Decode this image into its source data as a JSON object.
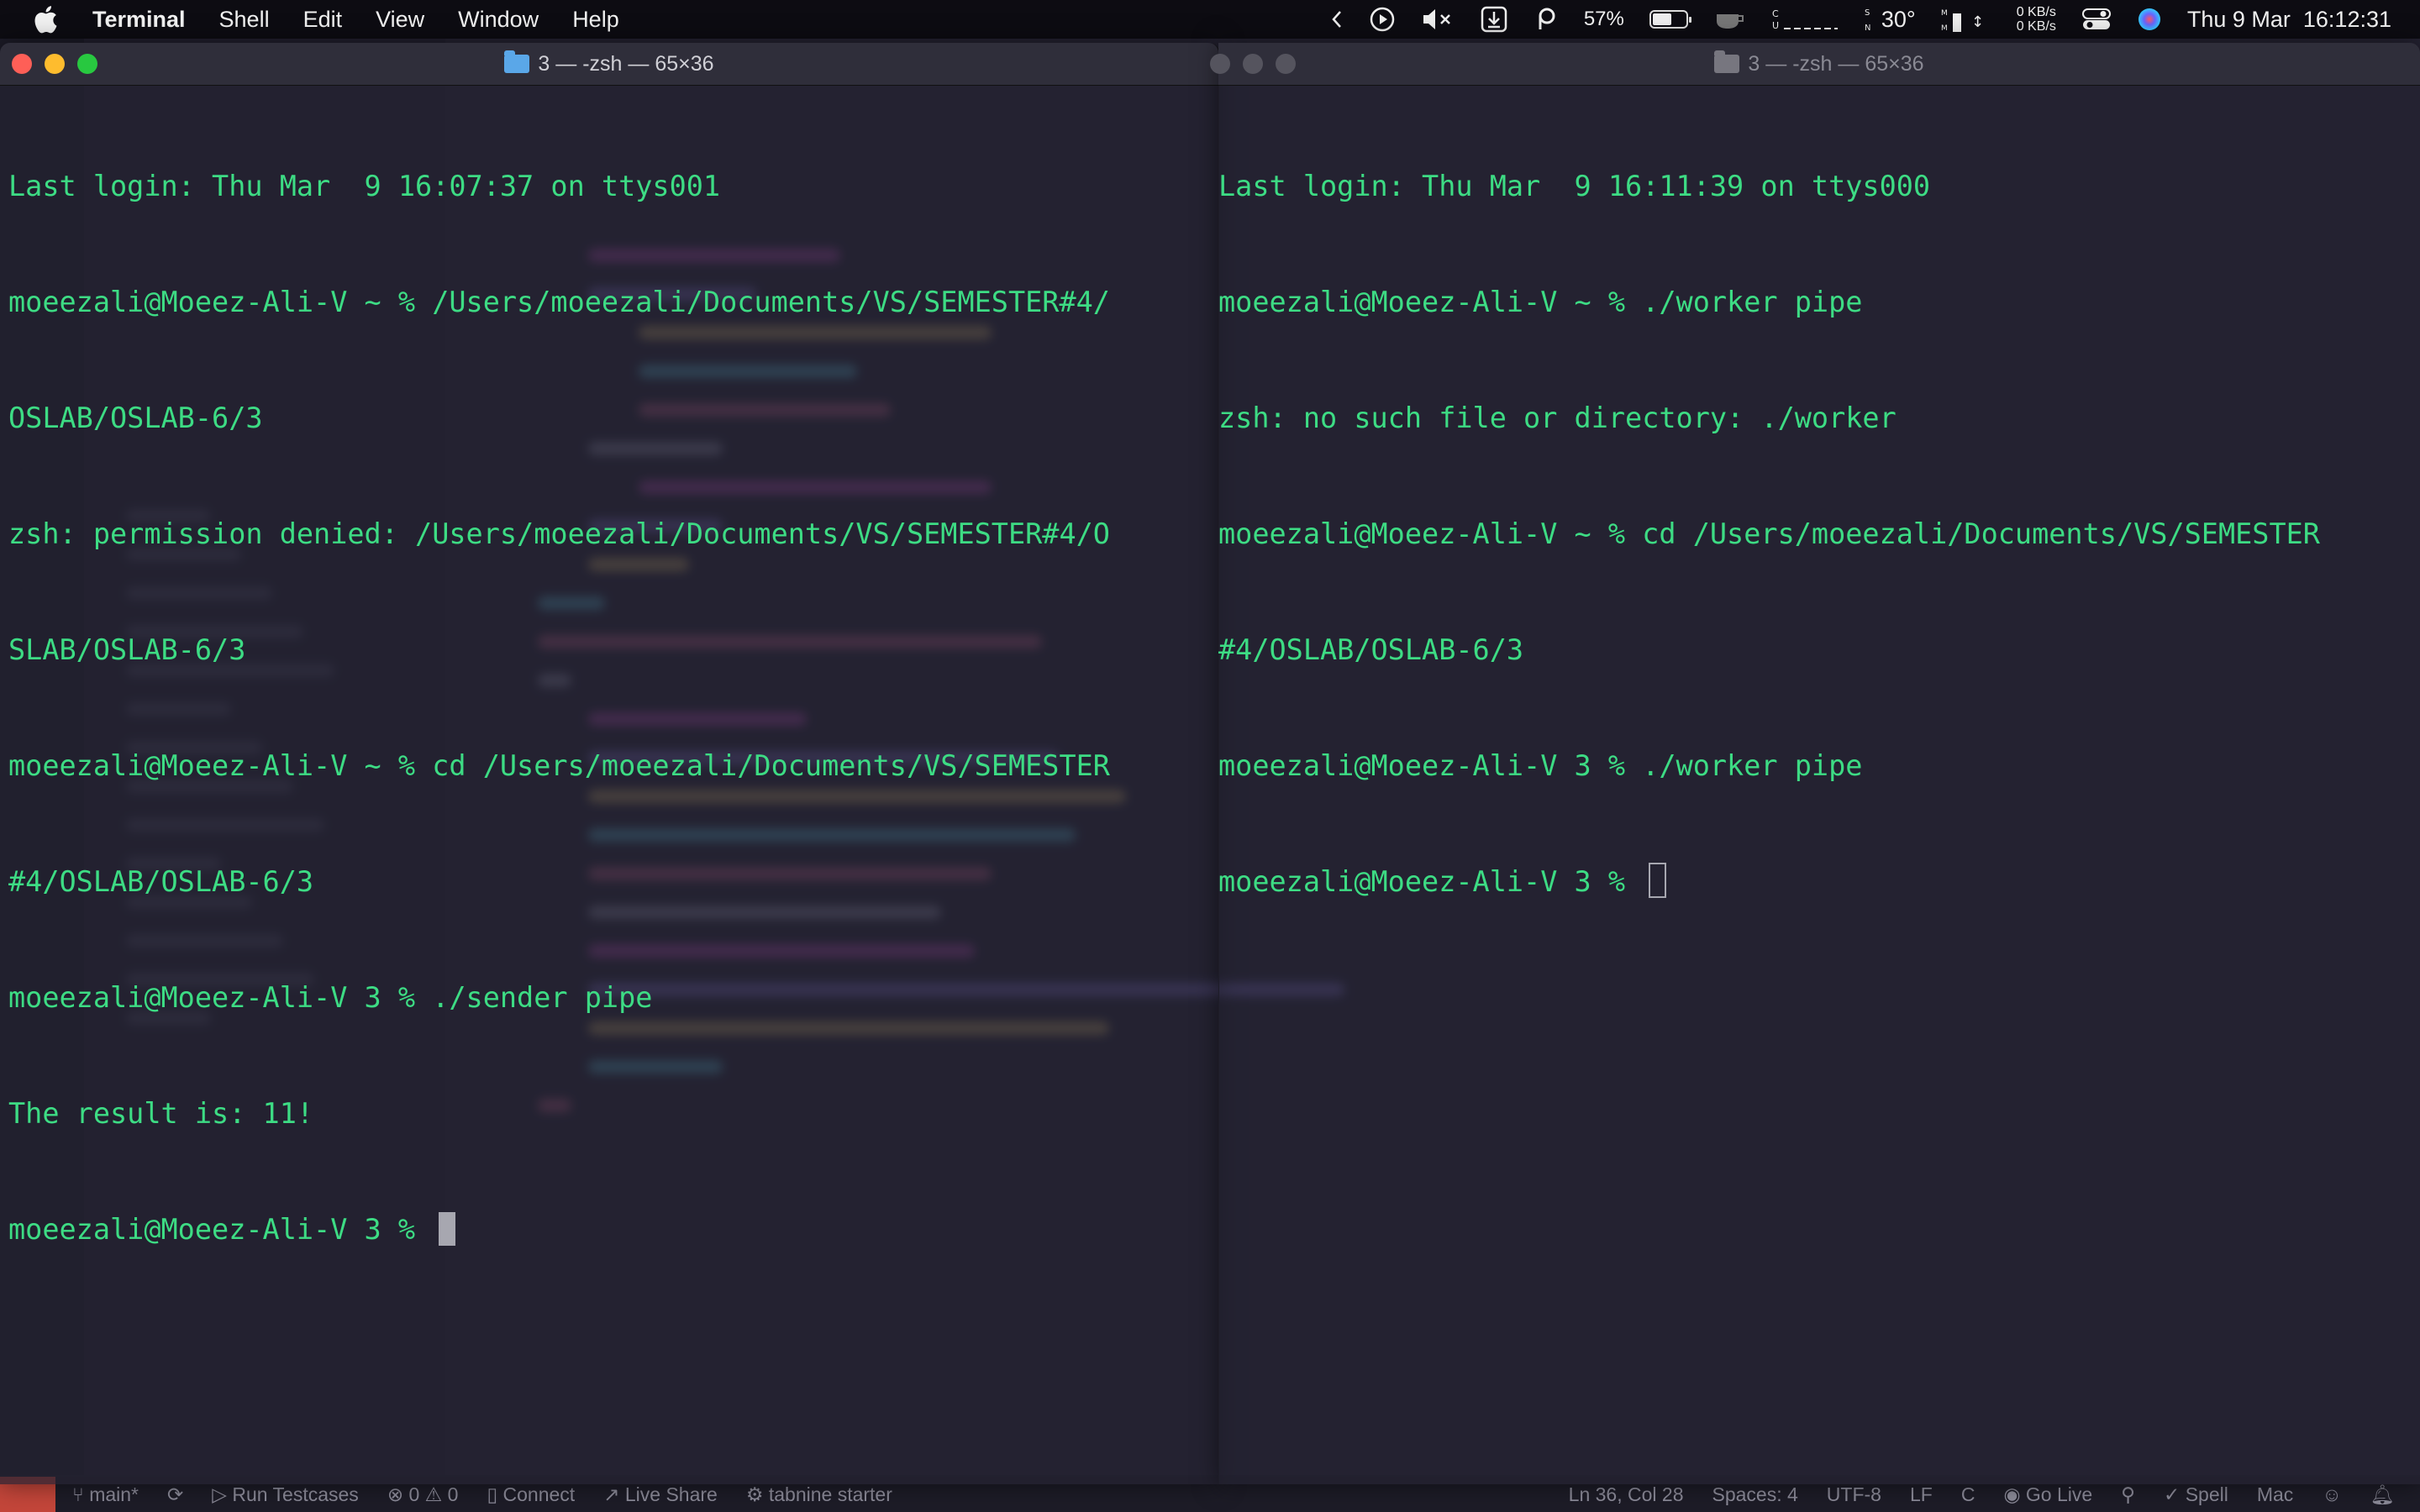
{
  "menubar": {
    "app_name": "Terminal",
    "menus": [
      "Shell",
      "Edit",
      "View",
      "Window",
      "Help"
    ],
    "battery_percent": "57%",
    "battery_level": 0.57,
    "temperature": "30°",
    "net_up": "0 KB/s",
    "net_down": "0 KB/s",
    "datetime": "Thu 9 Mar  16:12:31"
  },
  "left_terminal": {
    "title": "3 — -zsh — 65×36",
    "lines": [
      "Last login: Thu Mar  9 16:07:37 on ttys001",
      "moeezali@Moeez-Ali-V ~ % /Users/moeezali/Documents/VS/SEMESTER#4/",
      "OSLAB/OSLAB-6/3",
      "zsh: permission denied: /Users/moeezali/Documents/VS/SEMESTER#4/O",
      "SLAB/OSLAB-6/3",
      "moeezali@Moeez-Ali-V ~ % cd /Users/moeezali/Documents/VS/SEMESTER",
      "#4/OSLAB/OSLAB-6/3",
      "moeezali@Moeez-Ali-V 3 % ./sender pipe",
      "The result is: 11!"
    ],
    "prompt": "moeezali@Moeez-Ali-V 3 % "
  },
  "right_terminal": {
    "title": "3 — -zsh — 65×36",
    "lines": [
      "Last login: Thu Mar  9 16:11:39 on ttys000",
      "moeezali@Moeez-Ali-V ~ % ./worker pipe",
      "zsh: no such file or directory: ./worker",
      "moeezali@Moeez-Ali-V ~ % cd /Users/moeezali/Documents/VS/SEMESTER",
      "#4/OSLAB/OSLAB-6/3",
      "moeezali@Moeez-Ali-V 3 % ./worker pipe"
    ],
    "prompt": "moeezali@Moeez-Ali-V 3 % "
  },
  "statusbar": {
    "branch": "main*",
    "run_testcases": "Run Testcases",
    "problems": "⊗ 0 ⚠ 0",
    "connect": "Connect",
    "live_share": "Live Share",
    "tabnine": "tabnine starter",
    "cursor_pos": "Ln 36, Col 28",
    "spaces": "Spaces: 4",
    "encoding": "UTF-8",
    "eol": "LF",
    "language": "C",
    "go_live": "Go Live",
    "spell": "Spell",
    "platform": "Mac"
  },
  "colors": {
    "terminal_text": "#3ddc84",
    "close": "#fe5f57",
    "minimize": "#febc2e",
    "maximize": "#28c840"
  }
}
